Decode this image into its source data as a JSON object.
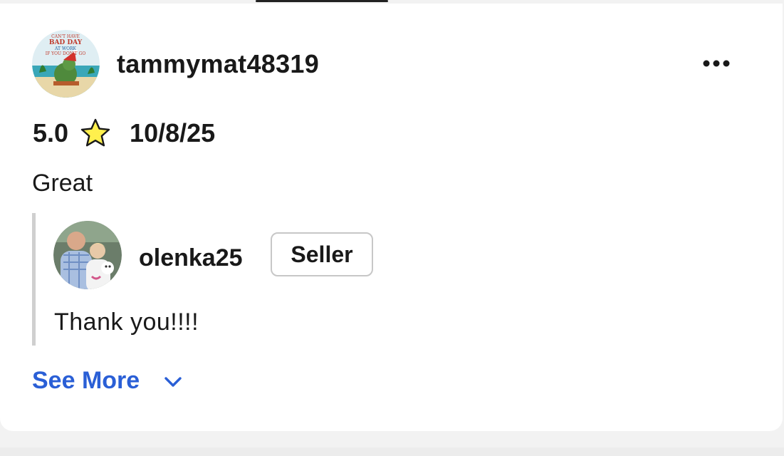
{
  "review": {
    "reviewer": {
      "username": "tammymat48319",
      "avatar_icon": "reviewer-avatar-cartoon"
    },
    "more_icon": "more-horizontal-icon",
    "rating": "5.0",
    "star_icon": "star-icon",
    "date": "10/8/25",
    "text": "Great"
  },
  "reply": {
    "username": "olenka25",
    "avatar_icon": "seller-avatar-photo",
    "badge": "Seller",
    "text": "Thank you!!!!"
  },
  "see_more": {
    "label": "See More",
    "icon": "chevron-down-icon"
  },
  "colors": {
    "link": "#2a5fd6",
    "text": "#191919",
    "star_fill": "#fff04d",
    "divider": "#cfcfcf"
  }
}
